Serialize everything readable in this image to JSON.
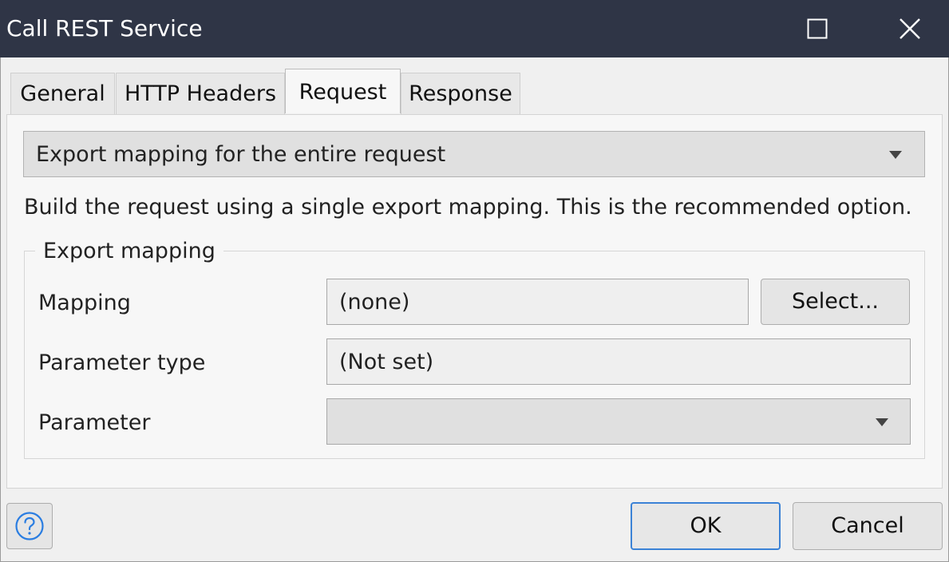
{
  "window": {
    "title": "Call REST Service"
  },
  "tabs": [
    {
      "label": "General",
      "active": false
    },
    {
      "label": "HTTP Headers",
      "active": false
    },
    {
      "label": "Request",
      "active": true
    },
    {
      "label": "Response",
      "active": false
    }
  ],
  "request": {
    "type_selected": "Export mapping for the entire request",
    "description": "Build the request using a single export mapping. This is the recommended option.",
    "group_title": "Export mapping",
    "mapping_label": "Mapping",
    "mapping_value": "(none)",
    "select_button": "Select...",
    "parameter_type_label": "Parameter type",
    "parameter_type_value": "(Not set)",
    "parameter_label": "Parameter",
    "parameter_value": ""
  },
  "footer": {
    "ok": "OK",
    "cancel": "Cancel"
  },
  "icons": {
    "maximize": "maximize-icon",
    "close": "close-icon",
    "help": "help-icon",
    "dropdown": "dropdown-caret-icon"
  },
  "colors": {
    "titlebar": "#2f3546",
    "primary_border": "#3b82d6",
    "help_icon": "#2a7de1"
  }
}
